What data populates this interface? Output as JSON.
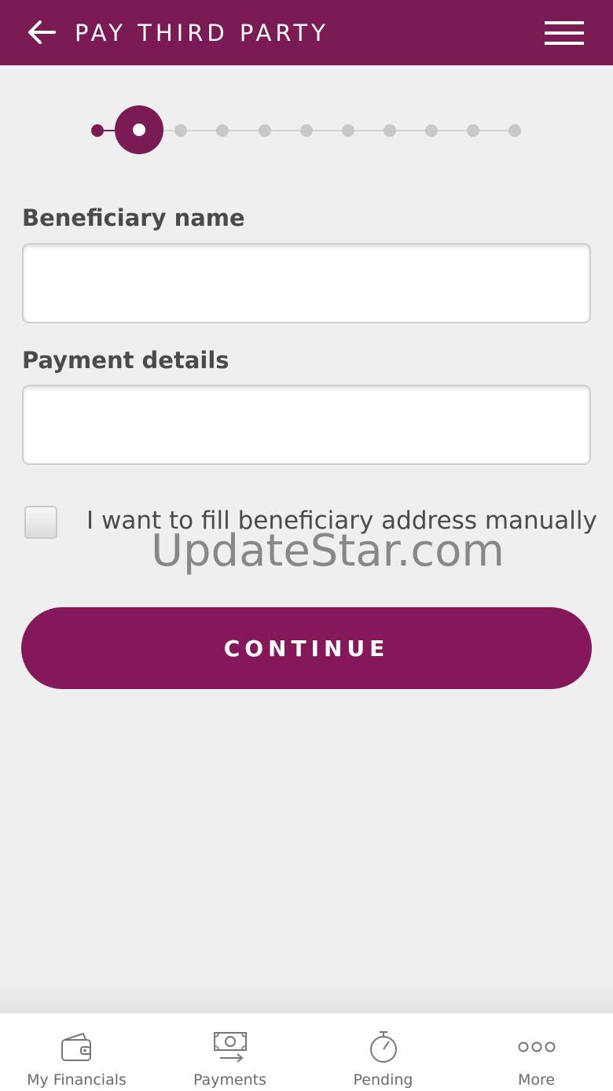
{
  "header": {
    "title": "PAY THIRD PARTY",
    "back_icon": "arrow-left-icon",
    "menu_icon": "hamburger-menu-icon",
    "background": "#7b1b56"
  },
  "stepper": {
    "total_steps": 11,
    "current_step": 2
  },
  "form": {
    "beneficiary_label": "Beneficiary name",
    "beneficiary_value": "",
    "payment_label": "Payment details",
    "payment_value": "",
    "manual_address_label": "I want to fill beneficiary address manually",
    "manual_address_checked": false
  },
  "watermark": "UpdateStar.com",
  "continue_label": "CONTINUE",
  "accent_color": "#84185a",
  "bottom_nav": [
    {
      "label": "My Financials",
      "icon": "wallet-icon"
    },
    {
      "label": "Payments",
      "icon": "money-transfer-icon"
    },
    {
      "label": "Pending",
      "icon": "stopwatch-icon"
    },
    {
      "label": "More",
      "icon": "more-dots-icon"
    }
  ]
}
